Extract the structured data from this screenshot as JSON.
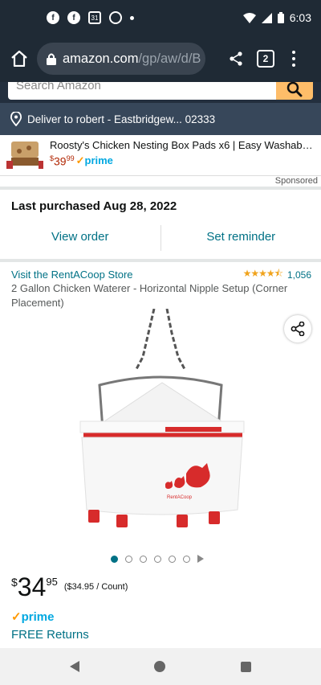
{
  "status_bar": {
    "time": "6:03",
    "calendar_day": "31"
  },
  "browser": {
    "url_host": "amazon.com",
    "url_path": "/gp/aw/d/B",
    "tab_count": "2"
  },
  "search": {
    "placeholder": "Search Amazon"
  },
  "delivery": {
    "text": "Deliver to robert - Eastbridgew... 02333"
  },
  "sponsored_ad": {
    "title": "Roosty's Chicken Nesting Box Pads x6 | Easy Washable...",
    "price_symbol": "$",
    "price_whole": "39",
    "price_fraction": "99",
    "prime_label": "prime",
    "sponsored_label": "Sponsored"
  },
  "purchase_history": {
    "text": "Last purchased Aug 28, 2022",
    "view_order_label": "View order",
    "set_reminder_label": "Set reminder"
  },
  "product": {
    "store_link": "Visit the RentACoop Store",
    "rating_value": 4.5,
    "rating_stars": "★★★★⯪",
    "rating_count": "1,056",
    "title": "2 Gallon Chicken Waterer - Horizontal Nipple Setup (Corner Placement)",
    "image_brand": "RentACoop",
    "image_count": 6,
    "active_image_index": 0,
    "price_symbol": "$",
    "price_whole": "34",
    "price_fraction": "95",
    "price_per_unit": "($34.95 / Count)",
    "prime_label": "prime",
    "free_returns": "FREE Returns"
  },
  "colors": {
    "status_bg": "#1f2a35",
    "amazon_nav": "#232f3e",
    "deliver_bar": "#37475a",
    "search_button": "#febd69",
    "link": "#007185",
    "price_red": "#b12704",
    "prime_blue": "#00a8e1"
  }
}
